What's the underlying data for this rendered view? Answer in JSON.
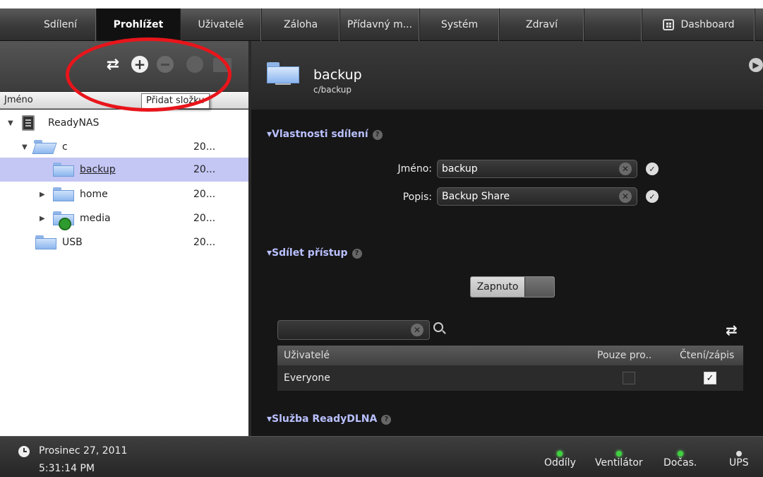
{
  "nav": {
    "tabs": [
      {
        "label": "Sdílení"
      },
      {
        "label": "Prohlížet"
      },
      {
        "label": "Uživatelé"
      },
      {
        "label": "Záloha"
      },
      {
        "label": "Přídavný m..."
      },
      {
        "label": "Systém"
      },
      {
        "label": "Zdraví"
      },
      {
        "label": ""
      },
      {
        "label": "Dashboard"
      }
    ]
  },
  "sidebar": {
    "column_name": "Jméno",
    "tooltip": "Přidat složku",
    "tree": [
      {
        "label": "ReadyNAS",
        "date": ""
      },
      {
        "label": "c",
        "date": "20..."
      },
      {
        "label": "backup",
        "date": "20..."
      },
      {
        "label": "home",
        "date": "20..."
      },
      {
        "label": "media",
        "date": "20..."
      },
      {
        "label": "USB",
        "date": "20..."
      }
    ]
  },
  "detail": {
    "title": "backup",
    "path": "c/backup",
    "share_props": {
      "title": "Vlastnosti sdílení",
      "name_label": "Jméno:",
      "name_value": "backup",
      "desc_label": "Popis:",
      "desc_value": "Backup Share"
    },
    "share_access": {
      "title": "Sdílet přístup",
      "toggle_label": "Zapnuto",
      "search_value": "",
      "columns": [
        "Uživatelé",
        "Pouze pro..",
        "Čtení/zápis"
      ],
      "rows": [
        {
          "user": "Everyone",
          "read_only": false,
          "read_write": true
        }
      ]
    },
    "dlna": {
      "title": "Služba ReadyDLNA"
    }
  },
  "footer": {
    "date": "Prosinec 27, 2011",
    "time": "5:31:14 PM",
    "statuses": [
      {
        "label": "Oddíly",
        "ok": true
      },
      {
        "label": "Ventilátor",
        "ok": true
      },
      {
        "label": "Dočas.",
        "ok": true
      },
      {
        "label": "UPS",
        "ok": false
      }
    ]
  },
  "colors": {
    "accent_section": "#b9c0ff",
    "selected_row": "#c4c6f4",
    "annotation_red": "#e8151b",
    "status_green": "#3fd13f"
  }
}
